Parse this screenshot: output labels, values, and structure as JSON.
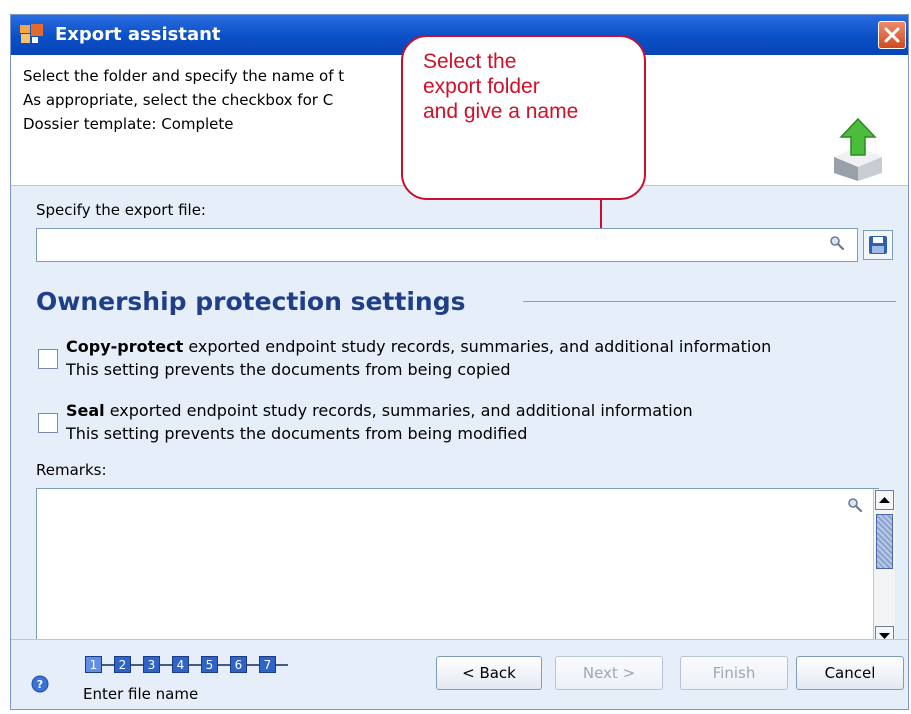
{
  "window": {
    "title": "Export assistant",
    "description_lines": [
      "Select the folder and specify the name of t",
      "As appropriate, select the checkbox for C",
      "Dossier template: Complete"
    ]
  },
  "callout": {
    "text": "Select the\nexport folder\nand give a name"
  },
  "export_file": {
    "label": "Specify the export file:",
    "value": "",
    "placeholder": ""
  },
  "ownership": {
    "title": "Ownership protection settings",
    "options": [
      {
        "bold": "Copy-protect",
        "text": " exported endpoint study records, summaries, and additional information",
        "sub": "This setting prevents the documents from being copied",
        "checked": false
      },
      {
        "bold": "Seal",
        "text": " exported endpoint study records, summaries, and additional information",
        "sub": "This setting prevents the documents from being modified",
        "checked": false
      }
    ]
  },
  "remarks": {
    "label": "Remarks:",
    "value": ""
  },
  "wizard": {
    "steps": [
      "1",
      "2",
      "3",
      "4",
      "5",
      "6",
      "7"
    ],
    "current_step": 1,
    "caption": "Enter file name"
  },
  "buttons": {
    "back": "< Back",
    "next": "Next >",
    "finish": "Finish",
    "cancel": "Cancel"
  },
  "colors": {
    "titlebar": "#0b4fc7",
    "section_title": "#1f3f88",
    "callout": "#c8102e",
    "step": "#2e64c8"
  },
  "icons": {
    "app": "assistant-app-icon",
    "close": "close-icon",
    "export": "export-arrow-icon",
    "search": "magnifier-icon",
    "save": "save-disk-icon",
    "help": "help-icon"
  }
}
